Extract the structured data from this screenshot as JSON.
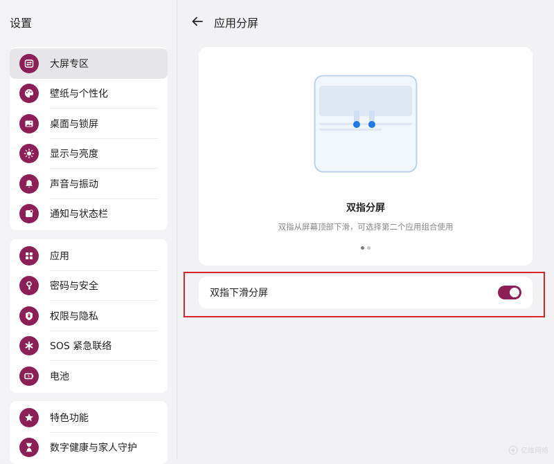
{
  "sidebar": {
    "title": "设置",
    "groups": [
      {
        "items": [
          {
            "label": "大屏专区",
            "icon": "large-screen-icon",
            "selected": true
          },
          {
            "label": "壁纸与个性化",
            "icon": "palette-icon"
          },
          {
            "label": "桌面与锁屏",
            "icon": "image-icon"
          },
          {
            "label": "显示与亮度",
            "icon": "sun-icon"
          },
          {
            "label": "声音与振动",
            "icon": "bell-icon"
          },
          {
            "label": "通知与状态栏",
            "icon": "notification-icon"
          }
        ]
      },
      {
        "items": [
          {
            "label": "应用",
            "icon": "apps-icon"
          },
          {
            "label": "密码与安全",
            "icon": "key-icon"
          },
          {
            "label": "权限与隐私",
            "icon": "shield-icon"
          },
          {
            "label": "SOS 紧急联络",
            "icon": "sos-asterisk-icon"
          },
          {
            "label": "电池",
            "icon": "battery-icon"
          }
        ]
      },
      {
        "items": [
          {
            "label": "特色功能",
            "icon": "star-icon"
          },
          {
            "label": "数字健康与家人守护",
            "icon": "hourglass-icon"
          }
        ]
      }
    ]
  },
  "header": {
    "title": "应用分屏"
  },
  "card": {
    "title": "双指分屏",
    "subtitle": "双指从屏幕顶部下滑，可选择第二个应用组合使用",
    "page_count": 2,
    "active_page": 1
  },
  "setting": {
    "label": "双指下滑分屏",
    "enabled": true
  },
  "watermark": "亿维网络",
  "colors": {
    "accent": "#8d1f57",
    "highlight": "#d8232a",
    "illus_blue": "#1e78e6"
  }
}
